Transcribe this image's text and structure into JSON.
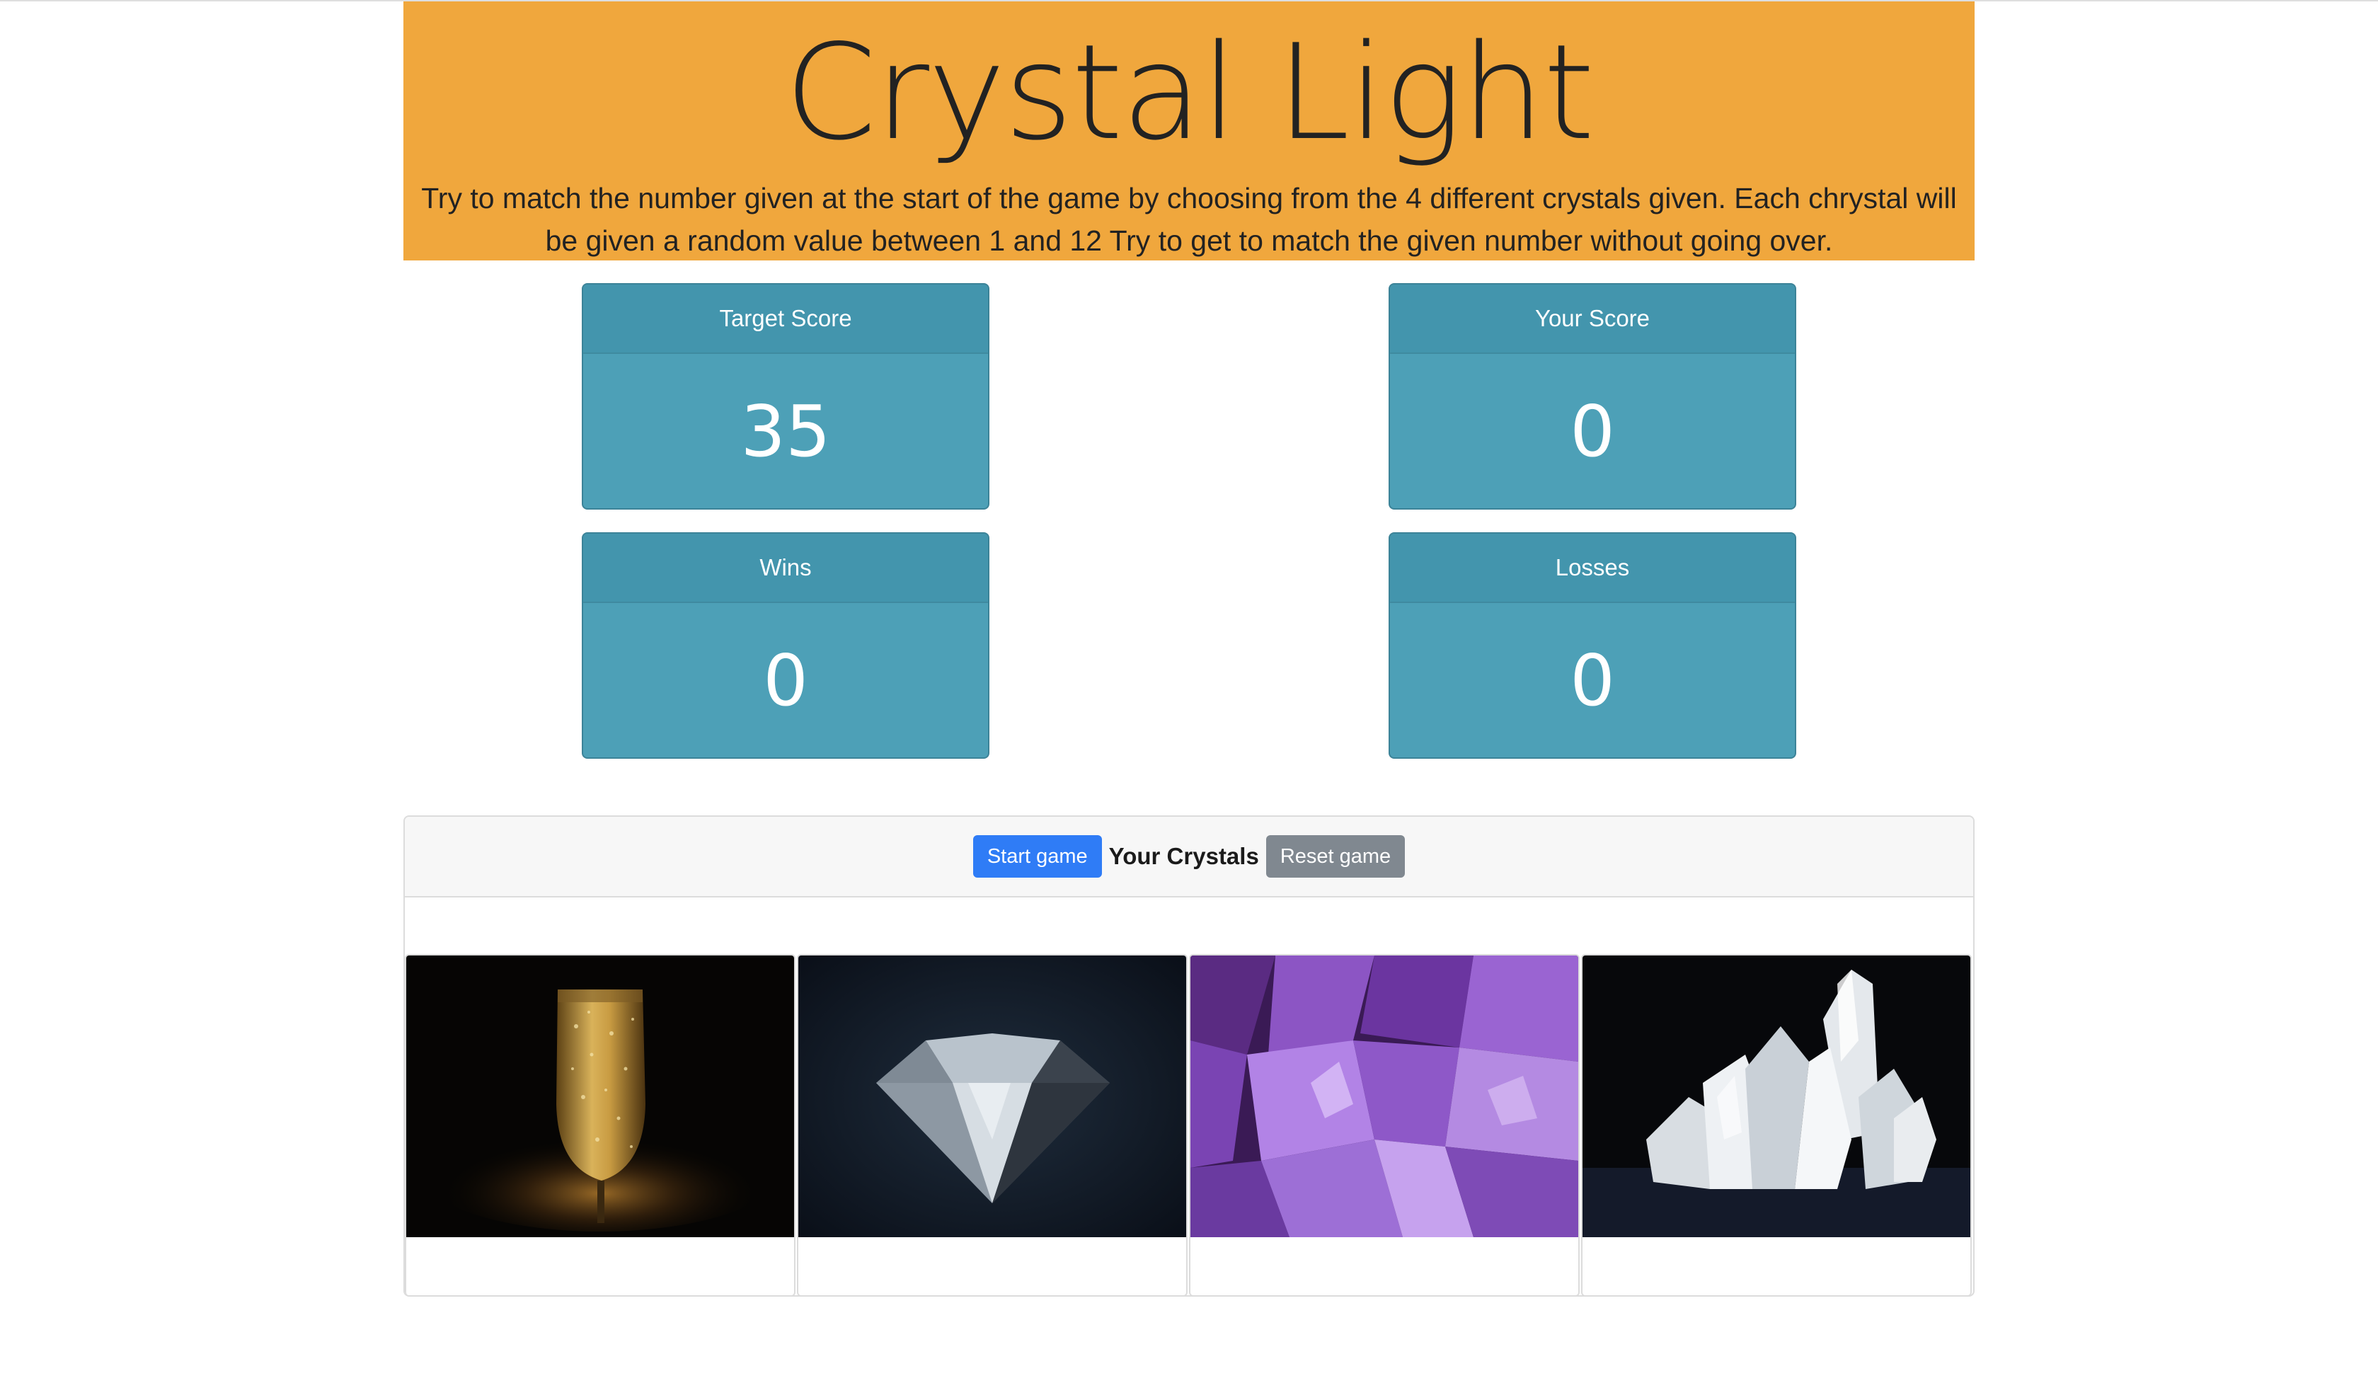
{
  "header": {
    "title": "Crystal Light",
    "instructions": "Try to match the number given at the start of the game by choosing from the 4 different crystals given. Each chrystal will be given a random value between 1 and 12 Try to get to match the given number without going over."
  },
  "scoreboard": {
    "target": {
      "label": "Target Score",
      "value": "35"
    },
    "score": {
      "label": "Your Score",
      "value": "0"
    },
    "wins": {
      "label": "Wins",
      "value": "0"
    },
    "losses": {
      "label": "Losses",
      "value": "0"
    }
  },
  "crystals_panel": {
    "start_label": "Start game",
    "title": "Your Crystals",
    "reset_label": "Reset game",
    "crystals": [
      {
        "icon": "champagne-glass-image"
      },
      {
        "icon": "diamond-image"
      },
      {
        "icon": "amethyst-image"
      },
      {
        "icon": "quartz-cluster-image"
      }
    ]
  },
  "colors": {
    "jumbotron": "#f0a73d",
    "card": "#4da0b7",
    "start_button": "#2f7cf6",
    "reset_button": "#808890"
  }
}
